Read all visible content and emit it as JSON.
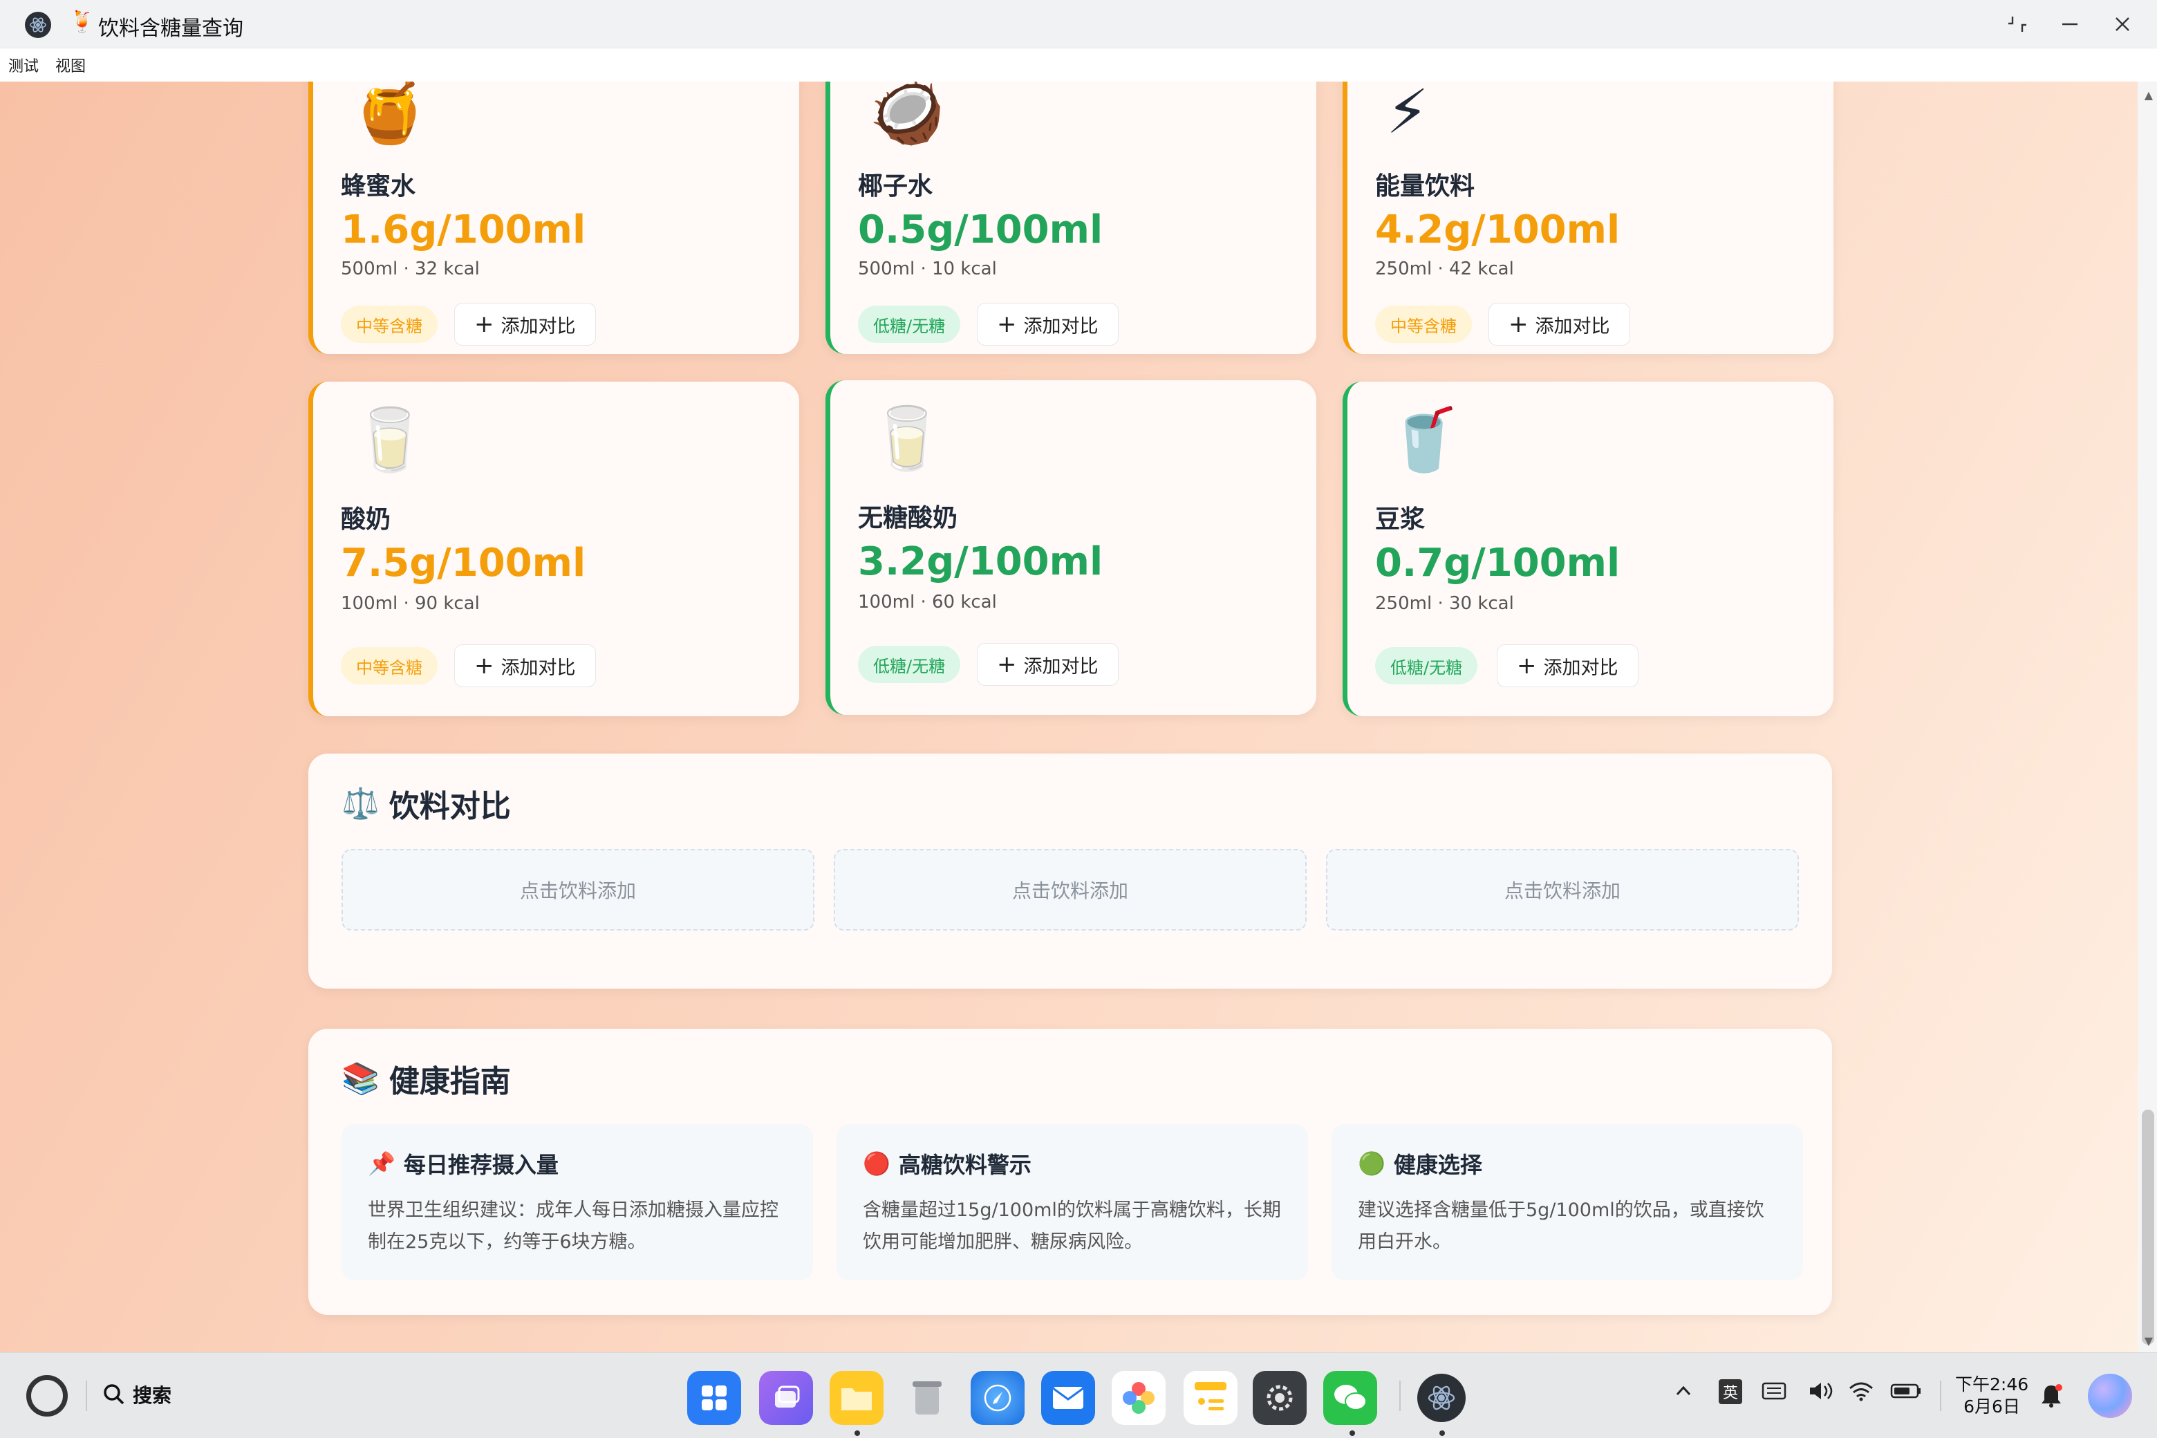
{
  "window": {
    "title": "饮料含糖量查询",
    "title_emoji": "🍹"
  },
  "menu": [
    "测试",
    "视图"
  ],
  "drinks": [
    {
      "emoji": "🍯",
      "name": "蜂蜜水",
      "sugar": "1.6g/100ml",
      "meta": "500ml · 32 kcal",
      "tag": "中等含糖",
      "level": "medium",
      "add": "添加对比"
    },
    {
      "emoji": "🥥",
      "name": "椰子水",
      "sugar": "0.5g/100ml",
      "meta": "500ml · 10 kcal",
      "tag": "低糖/无糖",
      "level": "low",
      "add": "添加对比"
    },
    {
      "emoji": "⚡",
      "name": "能量饮料",
      "sugar": "4.2g/100ml",
      "meta": "250ml · 42 kcal",
      "tag": "中等含糖",
      "level": "medium",
      "add": "添加对比"
    },
    {
      "emoji": "🥛",
      "name": "酸奶",
      "sugar": "7.5g/100ml",
      "meta": "100ml · 90 kcal",
      "tag": "中等含糖",
      "level": "medium",
      "add": "添加对比"
    },
    {
      "emoji": "🥛",
      "name": "无糖酸奶",
      "sugar": "3.2g/100ml",
      "meta": "100ml · 60 kcal",
      "tag": "低糖/无糖",
      "level": "low",
      "add": "添加对比"
    },
    {
      "emoji": "🥤",
      "name": "豆浆",
      "sugar": "0.7g/100ml",
      "meta": "250ml · 30 kcal",
      "tag": "低糖/无糖",
      "level": "low",
      "add": "添加对比"
    }
  ],
  "compare": {
    "icon": "⚖️",
    "title": "饮料对比",
    "slots": [
      "点击饮料添加",
      "点击饮料添加",
      "点击饮料添加"
    ]
  },
  "guide": {
    "icon": "📚",
    "title": "健康指南",
    "items": [
      {
        "icon": "📌",
        "title": "每日推荐摄入量",
        "body": "世界卫生组织建议：成年人每日添加糖摄入量应控制在25克以下，约等于6块方糖。"
      },
      {
        "icon": "🔴",
        "title": "高糖饮料警示",
        "body": "含糖量超过15g/100ml的饮料属于高糖饮料，长期饮用可能增加肥胖、糖尿病风险。"
      },
      {
        "icon": "🟢",
        "title": "健康选择",
        "body": "建议选择含糖量低于5g/100ml的饮品，或直接饮用白开水。"
      }
    ]
  },
  "taskbar": {
    "search_label": "搜索",
    "ime": "英",
    "time": "下午2:46",
    "date": "6月6日"
  },
  "colors": {
    "medium": "#f59e0b",
    "low": "#22a55a"
  }
}
